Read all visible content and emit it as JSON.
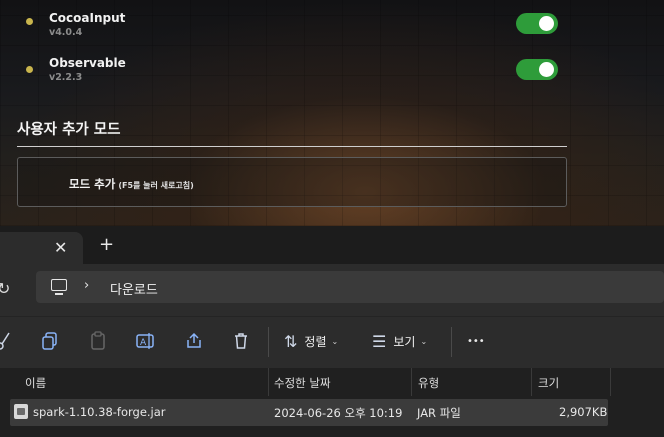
{
  "launcher": {
    "mods": [
      {
        "name": "CocoaInput",
        "version": "v4.0.4",
        "enabled": true
      },
      {
        "name": "Observable",
        "version": "v2.2.3",
        "enabled": true
      }
    ],
    "custom_section_title": "사용자 추가 모드",
    "add_mod_label": "모드 추가",
    "add_mod_hint": "(F5를 눌러 새로고침)",
    "colors": {
      "toggle_on": "#2e9c3a",
      "status_dot": "#c9b54d"
    }
  },
  "explorer": {
    "tab_close_glyph": "✕",
    "new_tab_glyph": "+",
    "breadcrumb": [
      "다운로드"
    ],
    "toolbar": {
      "sort_label": "정렬",
      "view_label": "보기",
      "more_glyph": "•••"
    },
    "columns": [
      "이름",
      "수정한 날짜",
      "유형",
      "크기"
    ],
    "files": [
      {
        "name": "spark-1.10.38-forge.jar",
        "modified": "2024-06-26 오후 10:19",
        "type": "JAR 파일",
        "size": "2,907KB"
      }
    ]
  }
}
